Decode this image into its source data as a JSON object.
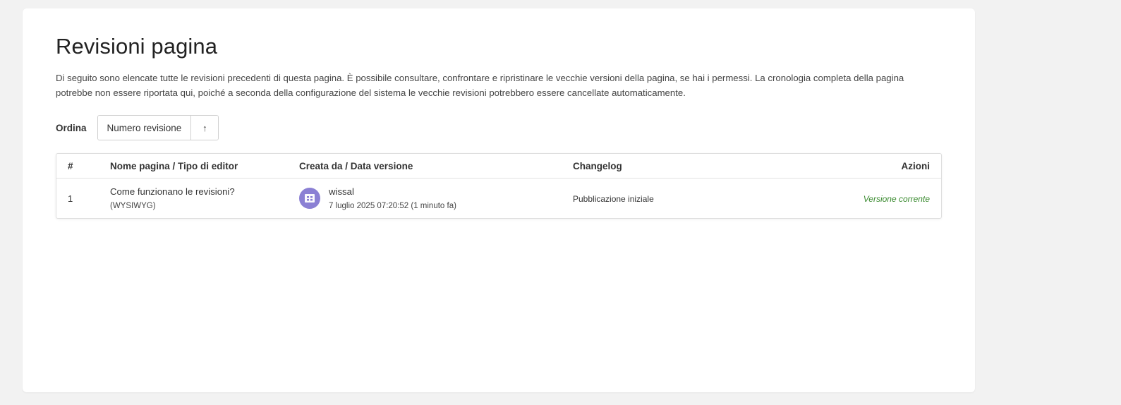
{
  "page": {
    "title": "Revisioni pagina",
    "intro": "Di seguito sono elencate tutte le revisioni precedenti di questa pagina. È possibile consultare, confrontare e ripristinare le vecchie versioni della pagina, se hai i permessi. La cronologia completa della pagina potrebbe non essere riportata qui, poiché a seconda della configurazione del sistema le vecchie revisioni potrebbero essere cancellate automaticamente."
  },
  "sort": {
    "label": "Ordina",
    "selected": "Numero revisione",
    "direction_icon": "arrow-up-icon",
    "direction_glyph": "↑"
  },
  "table": {
    "headers": {
      "num": "#",
      "name": "Nome pagina / Tipo di editor",
      "author": "Creata da / Data versione",
      "changelog": "Changelog",
      "actions": "Azioni"
    },
    "rows": [
      {
        "num": "1",
        "page_name": "Come funzionano le revisioni?",
        "editor": "(WYSIWYG)",
        "author": "wissal",
        "date": "7 luglio 2025 07:20:52 (1 minuto fa)",
        "changelog": "Pubblicazione iniziale",
        "action": "Versione corrente"
      }
    ]
  },
  "colors": {
    "background": "#f2f2f2",
    "card": "#ffffff",
    "avatar": "#8b80d4",
    "current_version": "#3a8a2f"
  }
}
